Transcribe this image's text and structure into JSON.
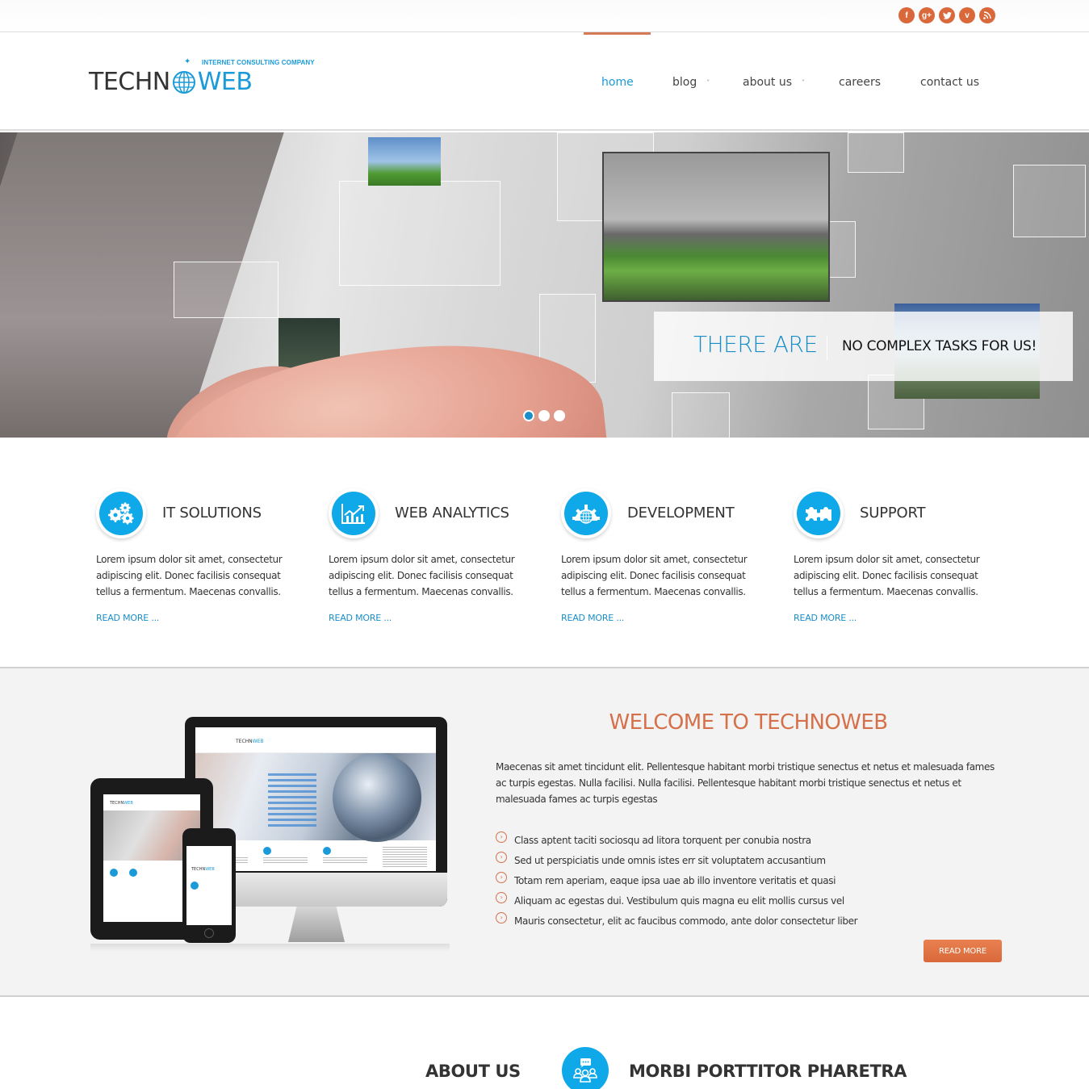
{
  "social": [
    {
      "name": "facebook",
      "glyph": "f"
    },
    {
      "name": "google-plus",
      "glyph": "g+"
    },
    {
      "name": "twitter",
      "glyph": "t"
    },
    {
      "name": "vimeo",
      "glyph": "v"
    },
    {
      "name": "rss",
      "glyph": "∷"
    }
  ],
  "logo": {
    "tagline": "INTERNET CONSULTING COMPANY",
    "part1": "TECHN",
    "part2": "WEB"
  },
  "nav": {
    "items": [
      {
        "label": "home",
        "active": true,
        "dropdown": false
      },
      {
        "label": "blog",
        "active": false,
        "dropdown": true
      },
      {
        "label": "about us",
        "active": false,
        "dropdown": true
      },
      {
        "label": "careers",
        "active": false,
        "dropdown": false
      },
      {
        "label": "contact us",
        "active": false,
        "dropdown": false
      }
    ],
    "caret": "˅"
  },
  "slider": {
    "caption_highlight": "THERE ARE",
    "caption_text": "NO COMPLEX TASKS FOR US!",
    "slide_count": 3,
    "active_slide": 1
  },
  "features": [
    {
      "title": "IT SOLUTIONS",
      "icon": "gears-icon",
      "text": "Lorem ipsum dolor sit amet, consectetur adipiscing elit. Donec facilisis consequat tellus a fermentum. Maecenas convallis.",
      "link": "READ MORE ..."
    },
    {
      "title": "WEB ANALYTICS",
      "icon": "chart-icon",
      "text": "Lorem ipsum dolor sit amet, consectetur adipiscing elit. Donec facilisis consequat tellus a fermentum. Maecenas convallis.",
      "link": "READ MORE ..."
    },
    {
      "title": "DEVELOPMENT",
      "icon": "globe-gear-icon",
      "text": "Lorem ipsum dolor sit amet, consectetur adipiscing elit. Donec facilisis consequat tellus a fermentum. Maecenas convallis.",
      "link": "READ MORE ..."
    },
    {
      "title": "SUPPORT",
      "icon": "puzzle-icon",
      "text": "Lorem ipsum dolor sit amet, consectetur adipiscing elit. Donec facilisis consequat tellus a fermentum. Maecenas convallis.",
      "link": "READ MORE ..."
    }
  ],
  "welcome": {
    "title": "WELCOME TO TECHNOWEB",
    "text": "Maecenas sit amet tincidunt elit. Pellentesque habitant morbi tristique senectus et netus et malesuada fames ac turpis egestas. Nulla facilisi. Nulla facilisi. Pellentesque habitant morbi tristique senectus et netus et malesuada fames ac turpis egestas",
    "list": [
      "Class aptent taciti sociosqu ad litora torquent per conubia nostra",
      "Sed ut perspiciatis unde omnis istes err sit voluptatem accusantium",
      "Totam rem aperiam, eaque ipsa uae ab illo inventore veritatis et quasi",
      "Aliquam ac egestas dui. Vestibulum quis magna eu elit mollis cursus vel",
      "Mauris consectetur, elit ac faucibus commodo, ante dolor consectetur liber"
    ],
    "bullet": "›",
    "button": "READ MORE",
    "mockup": {
      "logo1": "TECHN",
      "logo2": "WEB"
    }
  },
  "about": {
    "title": "ABOUT US",
    "subtitle": "MORBI PORTTITOR PHARETRA"
  },
  "colors": {
    "accent_blue": "#1a9ad8",
    "icon_blue": "#0fa8e8",
    "accent_orange": "#d9693a",
    "welcome_bg": "#f3f3f3"
  }
}
